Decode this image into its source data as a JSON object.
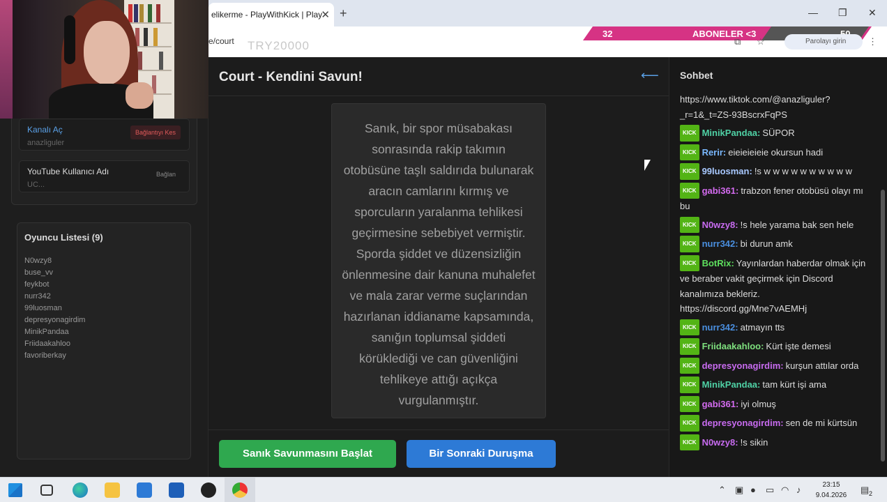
{
  "browser": {
    "tab_title": "elikerme - PlayWithKick | Play",
    "url": "e/court",
    "url_ghost": "TRY20000",
    "profile_label": "Parolayı girin"
  },
  "sub_banner": {
    "current": "32",
    "label": "ABONELER <3",
    "target": "50"
  },
  "sidebar": {
    "connections": [
      {
        "title": "Kanalı Aç",
        "subtitle": "anazliguler",
        "button": "Bağlantıyı Kes"
      },
      {
        "title": "YouTube Kullanıcı Adı",
        "subtitle": "UC...",
        "button": "Bağlan"
      }
    ],
    "players_title": "Oyuncu Listesi (9)",
    "players": [
      "N0wzy8",
      "buse_vv",
      "feykbot",
      "nurr342",
      "99luosman",
      "depresyonagirdim",
      "MinikPandaa",
      "Friidaakahloo",
      "favoriberkay"
    ]
  },
  "main": {
    "title": "Court - Kendini Savun!",
    "case_text": "Sanık, bir spor müsabakası sonrasında rakip takımın otobüsüne taşlı saldırıda bulunarak aracın camlarını kırmış ve sporcuların yaralanma tehlikesi geçirmesine sebebiyet vermiştir. Sporda şiddet ve düzensizliğin önlenmesine dair kanuna muhalefet ve mala zarar verme suçlarından hazırlanan iddianame kapsamında, sanığın toplumsal şiddeti körüklediği ve can güvenliğini tehlikeye attığı açıkça vurgulanmıştır.",
    "btn_start": "Sanık Savunmasını Başlat",
    "btn_next": "Bir Sonraki Duruşma"
  },
  "chat": {
    "title": "Sohbet",
    "badge": "KICK",
    "intro": "https://www.tiktok.com/@anazliguler?_r=1&_t=ZS-93BscrxFqPS",
    "messages": [
      {
        "user": "MinikPandaa:",
        "color": "#4fd1a5",
        "text": "SÜPOR"
      },
      {
        "user": "Rerir:",
        "color": "#7ab8ff",
        "text": "eieieieieie okursun hadi"
      },
      {
        "user": "99luosman:",
        "color": "#a8c8ff",
        "text": "!s w w w w w w w w w w"
      },
      {
        "user": "gabi361:",
        "color": "#d46bf0",
        "text": "trabzon fener otobüsü olayı mı bu"
      },
      {
        "user": "N0wzy8:",
        "color": "#c86bf0",
        "text": "!s hele yarama bak sen hele"
      },
      {
        "user": "nurr342:",
        "color": "#4a8fe0",
        "text": "bi durun amk"
      },
      {
        "user": "BotRix:",
        "color": "#5ee05e",
        "text": "Yayınlardan haberdar olmak için ve beraber vakit geçirmek için Discord kanalımıza bekleriz. https://discord.gg/Mne7vAEMHj"
      },
      {
        "user": "nurr342:",
        "color": "#4a8fe0",
        "text": "atmayın tts"
      },
      {
        "user": "Friidaakahloo:",
        "color": "#7ee07e",
        "text": "Kürt işte demesi"
      },
      {
        "user": "depresyonagirdim:",
        "color": "#c86bf0",
        "text": "kurşun attılar orda"
      },
      {
        "user": "MinikPandaa:",
        "color": "#4fd1a5",
        "text": "tam kürt işi ama"
      },
      {
        "user": "gabi361:",
        "color": "#d46bf0",
        "text": "iyi olmuş"
      },
      {
        "user": "depresyonagirdim:",
        "color": "#c86bf0",
        "text": "sen de mi kürtsün"
      },
      {
        "user": "N0wzy8:",
        "color": "#c86bf0",
        "text": "!s sikin"
      }
    ]
  },
  "taskbar": {
    "time": "23:15",
    "date": "9.04.2026",
    "notifications": "2"
  }
}
